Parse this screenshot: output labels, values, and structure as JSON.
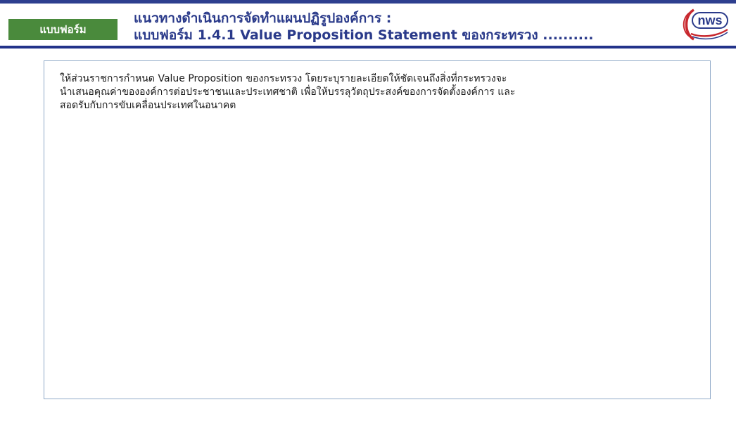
{
  "header": {
    "badge_label": "แบบฟอร์ม",
    "title_line1": "แนวทางดำเนินการจัดทำแผนปฏิรูปองค์การ :",
    "title_line2": "แบบฟอร์ม 1.4.1  Value Proposition Statement ของกระทรวง ..........",
    "logo_text": "nws",
    "logo_icon": "ocsc-logo-icon"
  },
  "content": {
    "instruction_lines": [
      "ให้ส่วนราชการกำหนด Value Proposition ของกระทรวง  โดยระบุรายละเอียดให้ชัดเจนถึงสิ่งที่กระทรวงจะ",
      "นำเสนอคุณค่าขององค์การต่อประชาชนและประเทศชาติ เพื่อให้บรรลุวัตถุประสงค์ของการจัดตั้งองค์การ และ",
      "สอดรับกับการขับเคลื่อนประเทศในอนาคต"
    ]
  },
  "colors": {
    "header_line": "#23338a",
    "badge_bg": "#4a8a3c",
    "title_text": "#2a3a8a",
    "logo_red": "#c8282e",
    "logo_blue": "#2a3a8a",
    "box_border": "#8fa9c8"
  }
}
